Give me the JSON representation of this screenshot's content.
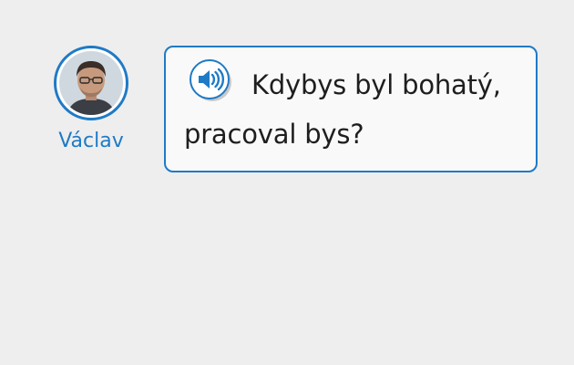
{
  "speaker": {
    "name": "Václav"
  },
  "bubble": {
    "text": "Kdybys byl bohatý, pracoval bys?"
  },
  "icons": {
    "audio": "speaker-volume-icon",
    "avatar": "person-portrait"
  },
  "colors": {
    "accent": "#1f7ac6",
    "background": "#eeeeee",
    "bubble_background": "#f9f9f9",
    "text": "#1e1e1e"
  }
}
